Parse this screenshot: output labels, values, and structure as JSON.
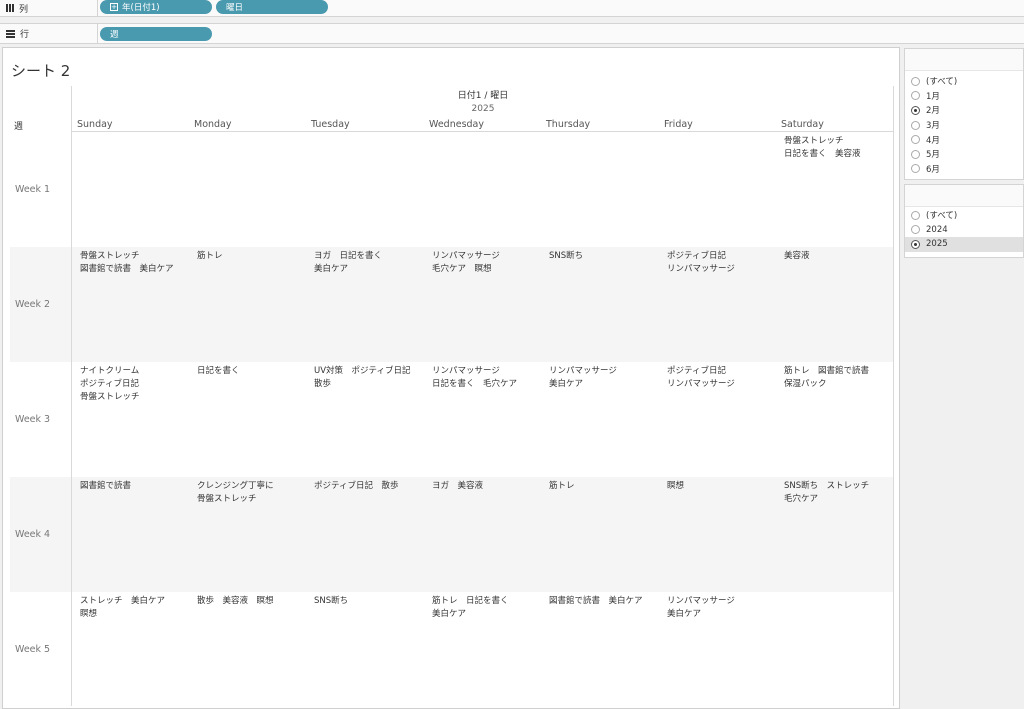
{
  "shelves": {
    "columns_label": "列",
    "rows_label": "行",
    "column_pills": [
      {
        "label": "年(日付1)",
        "has_expand": true
      },
      {
        "label": "曜日"
      }
    ],
    "row_pills": [
      {
        "label": "週"
      }
    ],
    "pill_color": "#4a9aaf"
  },
  "sheet": {
    "title": "シート 2",
    "header_top": "日付1 / 曜日",
    "header_year": "2025",
    "row_axis_label": "週",
    "days": [
      "Sunday",
      "Monday",
      "Tuesday",
      "Wednesday",
      "Thursday",
      "Friday",
      "Saturday"
    ],
    "weeks": [
      {
        "label": "Week 1",
        "cells": [
          "",
          "",
          "",
          "",
          "",
          "",
          "骨盤ストレッチ\n日記を書く　美容液"
        ]
      },
      {
        "label": "Week 2",
        "cells": [
          "骨盤ストレッチ\n図書館で読書　美白ケア",
          "筋トレ",
          "ヨガ　日記を書く\n美白ケア",
          "リンパマッサージ\n毛穴ケア　瞑想",
          "SNS断ち",
          "ポジティブ日記\nリンパマッサージ",
          "美容液"
        ]
      },
      {
        "label": "Week 3",
        "cells": [
          "ナイトクリーム\nポジティブ日記\n骨盤ストレッチ",
          "日記を書く",
          "UV対策　ポジティブ日記\n散歩",
          "リンパマッサージ\n日記を書く　毛穴ケア",
          "リンパマッサージ\n美白ケア",
          "ポジティブ日記\nリンパマッサージ",
          "筋トレ　図書館で読書\n保湿パック"
        ]
      },
      {
        "label": "Week 4",
        "cells": [
          "図書館で読書",
          "クレンジング丁寧に\n骨盤ストレッチ",
          "ポジティブ日記　散歩",
          "ヨガ　美容液",
          "筋トレ",
          "瞑想",
          "SNS断ち　ストレッチ\n毛穴ケア"
        ]
      },
      {
        "label": "Week 5",
        "cells": [
          "ストレッチ　美白ケア\n瞑想",
          "散歩　美容液　瞑想",
          "SNS断ち",
          "筋トレ　日記を書く\n美白ケア",
          "図書館で読書　美白ケア",
          "リンパマッサージ\n美白ケア",
          ""
        ]
      }
    ]
  },
  "filters": {
    "month": {
      "options": [
        "(すべて)",
        "1月",
        "2月",
        "3月",
        "4月",
        "5月",
        "6月"
      ],
      "selected": "2月"
    },
    "year": {
      "options": [
        "(すべて)",
        "2024",
        "2025"
      ],
      "selected": "2025"
    }
  }
}
